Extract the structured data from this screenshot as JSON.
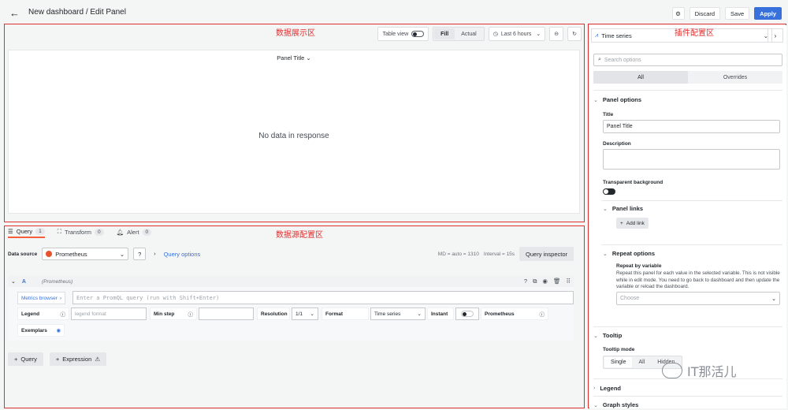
{
  "header": {
    "title": "New dashboard / Edit Panel",
    "discard": "Discard",
    "save": "Save",
    "apply": "Apply"
  },
  "annotations": {
    "panel_area": "数据展示区",
    "plugin_area": "插件配置区",
    "datasource_area": "数据源配置区"
  },
  "viz_toolbar": {
    "table_view": "Table view",
    "fill": "Fill",
    "actual": "Actual",
    "time_range": "Last 6 hours"
  },
  "panel": {
    "title": "Panel Title",
    "empty": "No data in response"
  },
  "query_tabs": [
    {
      "label": "Query",
      "count": "1"
    },
    {
      "label": "Transform",
      "count": "0"
    },
    {
      "label": "Alert",
      "count": "0"
    }
  ],
  "datasource": {
    "label": "Data source",
    "value": "Prometheus",
    "query_options": "Query options",
    "md": "MD = auto = 1310",
    "interval": "Interval = 15s",
    "inspector": "Query inspector"
  },
  "query": {
    "ref": "A",
    "ds": "(Prometheus)",
    "metrics_browser": "Metrics browser",
    "placeholder": "Enter a PromQL query (run with Shift+Enter)",
    "legend_label": "Legend",
    "legend_placeholder": "legend format",
    "min_step": "Min step",
    "resolution": "Resolution",
    "resolution_value": "1/1",
    "format": "Format",
    "format_value": "Time series",
    "instant": "Instant",
    "prometheus": "Prometheus",
    "exemplars": "Exemplars"
  },
  "add_buttons": {
    "query": "Query",
    "expression": "Expression"
  },
  "sidebar": {
    "viz_type": "Time series",
    "search_placeholder": "Search options",
    "tab_all": "All",
    "tab_overrides": "Overrides",
    "panel_options": "Panel options",
    "title_label": "Title",
    "title_value": "Panel Title",
    "description_label": "Description",
    "transparent_label": "Transparent background",
    "panel_links": "Panel links",
    "add_link": "Add link",
    "repeat_options": "Repeat options",
    "repeat_by": "Repeat by variable",
    "repeat_help": "Repeat this panel for each value in the selected variable. This is not visible while in edit mode. You need to go back to dashboard and then update the variable or reload the dashboard.",
    "choose": "Choose",
    "tooltip": "Tooltip",
    "tooltip_mode": "Tooltip mode",
    "mode_single": "Single",
    "mode_all": "All",
    "mode_hidden": "Hidden",
    "legend": "Legend",
    "graph_styles": "Graph styles"
  },
  "watermark": "IT那活儿",
  "colors": {
    "accent": "#3871dc",
    "annotation": "#e02f2f",
    "tab_underline": "#f55f3e"
  }
}
